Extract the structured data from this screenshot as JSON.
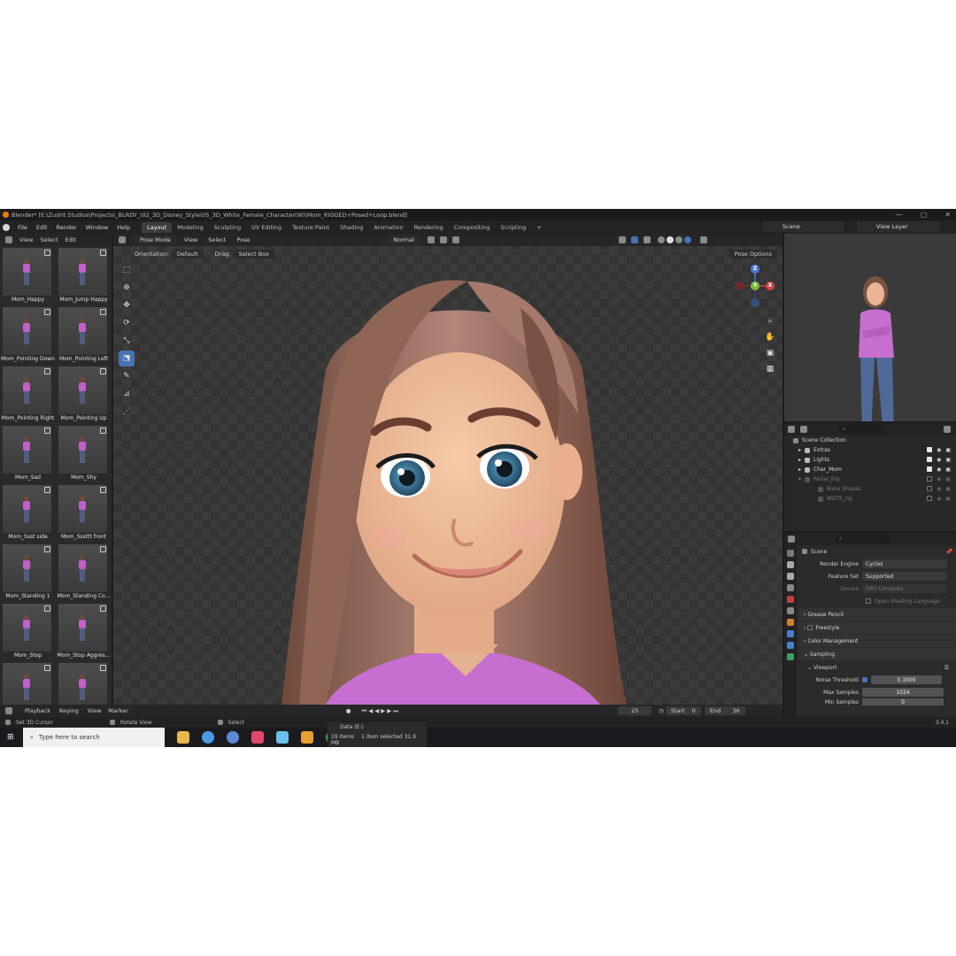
{
  "window": {
    "title": "Blender* [E:\\Zudrit Studios\\Projects\\_BLRDY_\\02_3D_Disney_Style\\05_3D_White_Female_Character(W)\\Mom_RIGGED+Posed+Loop.blend]"
  },
  "menu": [
    "File",
    "Edit",
    "Render",
    "Window",
    "Help"
  ],
  "workspaces": [
    {
      "label": "Layout",
      "active": true
    },
    {
      "label": "Modeling"
    },
    {
      "label": "Sculpting"
    },
    {
      "label": "UV Editing"
    },
    {
      "label": "Texture Paint"
    },
    {
      "label": "Shading"
    },
    {
      "label": "Animation"
    },
    {
      "label": "Rendering"
    },
    {
      "label": "Compositing"
    },
    {
      "label": "Scripting"
    }
  ],
  "add_workspace": "+",
  "scene": "Scene",
  "view_layer": "View Layer",
  "asset_browser": {
    "menu": [
      "View",
      "Select",
      "Edit"
    ],
    "assets": [
      "Mom_Happy",
      "Mom_Jump Happy",
      "Mom_Pointing Down",
      "Mom_Pointing Left",
      "Mom_Pointing Right",
      "Mom_Pointing Up",
      "Mom_Sad",
      "Mom_Shy",
      "Mom_Ssst side",
      "Mom_Sssttt front",
      "Mom_Standing 1",
      "Mom_Standing Co...",
      "Mom_Stop",
      "Mom_Stop Aggres...",
      "",
      ""
    ]
  },
  "viewport": {
    "mode": "Pose Mode",
    "menu": [
      "View",
      "Select",
      "Pose"
    ],
    "transform": "Normal",
    "orientation_label": "Orientation:",
    "orientation": "Default",
    "drag_label": "Drag:",
    "drag": "Select Box",
    "pose_options": "Pose Options",
    "gizmo": {
      "x": "X",
      "y": "Y",
      "z": "Z"
    }
  },
  "outliner": {
    "root": "Scene Collection",
    "items": [
      {
        "label": "Extras",
        "dim": false
      },
      {
        "label": "Lights",
        "dim": false
      },
      {
        "label": "Char_Mom",
        "dim": false
      },
      {
        "label": "Facial_Rig",
        "dim": true
      },
      {
        "label": "Bone Shapes",
        "dim": true
      },
      {
        "label": "WGTS_rig",
        "dim": true
      }
    ]
  },
  "properties": {
    "context": "Scene",
    "render_engine_label": "Render Engine",
    "render_engine": "Cycles",
    "feature_set_label": "Feature Set",
    "feature_set": "Supported",
    "device_label": "Device",
    "device": "GPU Compute",
    "osl_label": "Open Shading Language",
    "panels": [
      "Grease Pencil",
      "Freestyle",
      "Color Management",
      "Sampling"
    ],
    "subpanel": "Viewport",
    "noise_threshold_label": "Noise Threshold",
    "noise_threshold": "0.1000",
    "max_samples_label": "Max Samples",
    "max_samples": "1024",
    "min_samples_label": "Min Samples",
    "min_samples": "0"
  },
  "timeline": {
    "menu": [
      "Playback",
      "Keying",
      "View",
      "Marker"
    ],
    "current_frame": "25",
    "start_label": "Start",
    "start": "0",
    "end_label": "End",
    "end": "36"
  },
  "status": {
    "left": "Set 3D Cursor",
    "mid": "Rotate View",
    "right": "Select",
    "version": "3.4.1"
  },
  "taskbar": {
    "search_placeholder": "Type here to search",
    "explorer_drive": "Data (E:)",
    "explorer_items": "19 items",
    "explorer_selected": "1 item selected  31.9 MB"
  },
  "colors": {
    "accent": "#4772b3",
    "shirt": "#c76fd0",
    "hair": "#9a6d5a",
    "skin": "#f0bfa0",
    "eyes": "#3a7fa6"
  }
}
